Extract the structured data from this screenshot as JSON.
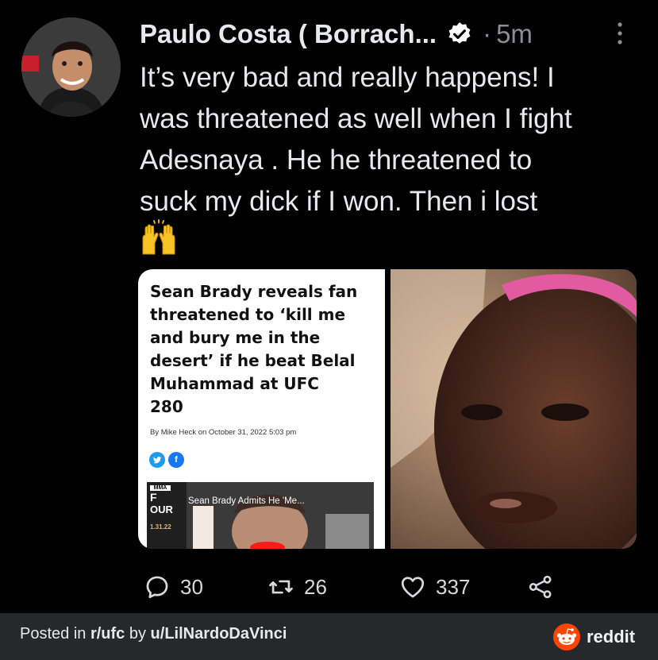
{
  "tweet": {
    "author_name": "Paulo Costa ( Borrach...",
    "timestamp": "5m",
    "separator": "·",
    "text_lines": [
      "It’s very bad and really happens! I",
      "was threatened as well when I fight",
      "Adesnaya . He he threatened to",
      "suck my dick if I won.  Then  i lost"
    ],
    "emoji": "raising-hands-emoji"
  },
  "media": {
    "article": {
      "headline_lines": [
        "Sean Brady reveals fan",
        "threatened to ‘kill me",
        "and bury me in the",
        "desert’ if he beat Belal",
        "Muhammad at UFC",
        "280"
      ],
      "byline": "By Mike Heck on October 31, 2022 5:03 pm",
      "share_icons": [
        "twitter-icon",
        "facebook-icon"
      ],
      "video_title": "Sean Brady Admits He 'Me...",
      "video_logo_top": "MMA",
      "video_logo_letter": "F",
      "video_logo_text": "OUR",
      "video_date": "1.31.22"
    }
  },
  "actions": {
    "replies": "30",
    "retweets": "26",
    "likes": "337"
  },
  "footer": {
    "posted_prefix": "Posted in ",
    "subreddit": "r/ufc",
    "by_text": " by ",
    "user": "u/LilNardoDaVinci",
    "brand": "reddit"
  },
  "colors": {
    "background": "#000000",
    "verified": "#ffffff",
    "footer_bg": "#26292b",
    "reddit_orange": "#ff4500",
    "twitter_blue": "#1d9bf0",
    "facebook_blue": "#1877f2"
  }
}
